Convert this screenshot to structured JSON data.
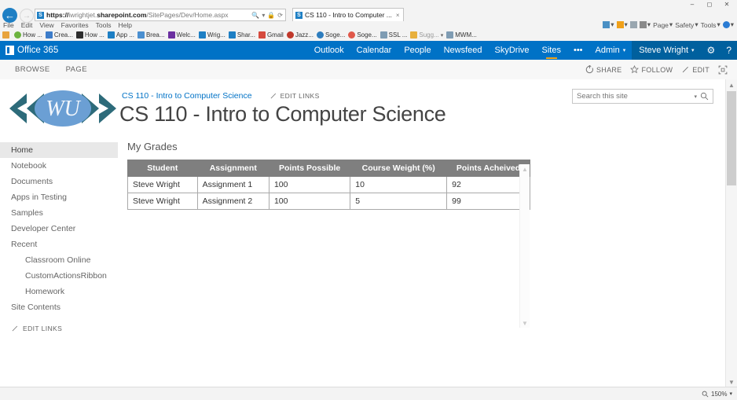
{
  "browser": {
    "window_controls": [
      "minimize",
      "restore",
      "close"
    ],
    "back_icon": "back-arrow-icon",
    "forward_icon": "forward-arrow-icon",
    "address": {
      "scheme": "https://",
      "host_dim": "iwrightjet.",
      "host_bold": "sharepoint.com",
      "path": "/SitePages/Dev/Home.aspx",
      "full_url": "https://iwrightjet.sharepoint.com/SitePages/Dev/Home.aspx",
      "search_icon": "search-icon",
      "lock_icon": "lock-icon",
      "refresh_icon": "refresh-icon"
    },
    "tab": {
      "title": "CS 110 - Intro to Computer ...",
      "close_label": "×"
    },
    "menus": [
      "File",
      "Edit",
      "View",
      "Favorites",
      "Tools",
      "Help"
    ],
    "command_items": [
      {
        "label": "",
        "icon": "home-icon",
        "color": "#4a90c4"
      },
      {
        "label": "",
        "icon": "feed-icon",
        "color": "#f0a019"
      },
      {
        "label": "",
        "icon": "mail-icon",
        "color": "#9aa7b0"
      },
      {
        "label": "",
        "icon": "print-icon",
        "color": "#6f6f6f"
      },
      {
        "label": "Page",
        "icon": "page-menu",
        "color": ""
      },
      {
        "label": "Safety",
        "icon": "safety-menu",
        "color": ""
      },
      {
        "label": "Tools",
        "icon": "tools-menu",
        "color": ""
      },
      {
        "label": "",
        "icon": "help-icon",
        "color": "#2b7cd3"
      }
    ],
    "bookmarks": [
      {
        "label": "",
        "icon": "home-bookmark-icon",
        "color": "#e8a33d"
      },
      {
        "label": "How ...",
        "icon": "favicon",
        "color": "#6cb33f"
      },
      {
        "label": "Crea...",
        "icon": "favicon",
        "color": "#3d7cc9"
      },
      {
        "label": "How ...",
        "icon": "favicon",
        "color": "#2d2d2d"
      },
      {
        "label": "App ...",
        "icon": "favicon",
        "color": "#1e7fc4"
      },
      {
        "label": "Brea...",
        "icon": "favicon",
        "color": "#4a8fd0"
      },
      {
        "label": "Welc...",
        "icon": "favicon",
        "color": "#6b2fa0"
      },
      {
        "label": "Wrig...",
        "icon": "favicon",
        "color": "#1e7fc4"
      },
      {
        "label": "Shar...",
        "icon": "favicon",
        "color": "#1e7fc4"
      },
      {
        "label": "Gmail",
        "icon": "gmail-icon",
        "color": "#d64b3e"
      },
      {
        "label": "Jazz...",
        "icon": "favicon",
        "color": "#c0392b"
      },
      {
        "label": "Soge...",
        "icon": "favicon",
        "color": "#2e7dbe"
      },
      {
        "label": "Soge...",
        "icon": "favicon",
        "color": "#e0584a"
      },
      {
        "label": "SSL ...",
        "icon": "favicon",
        "color": "#7f9cb3"
      },
      {
        "label": "Sugg...",
        "icon": "folder-icon",
        "color": "#e8b03d"
      },
      {
        "label": "MWM...",
        "icon": "favicon",
        "color": "#7f9cb3"
      }
    ],
    "status": {
      "zoom": "150%",
      "zoom_icon": "zoom-icon"
    }
  },
  "suitebar": {
    "brand": "Office 365",
    "brand_icon": "office-tile-icon",
    "links": [
      {
        "label": "Outlook",
        "active": false
      },
      {
        "label": "Calendar",
        "active": false
      },
      {
        "label": "People",
        "active": false
      },
      {
        "label": "Newsfeed",
        "active": false
      },
      {
        "label": "SkyDrive",
        "active": false
      },
      {
        "label": "Sites",
        "active": true
      }
    ],
    "overflow": "•••",
    "admin": "Admin",
    "user": "Steve Wright",
    "settings_icon": "gear-icon",
    "help_icon": "help-icon",
    "accent_color": "#0072c6",
    "accent_dark": "#00609e",
    "active_underline_color": "#f2a416"
  },
  "ribbon": {
    "tabs": [
      {
        "label": "BROWSE"
      },
      {
        "label": "PAGE"
      }
    ],
    "actions": [
      {
        "label": "SHARE",
        "icon": "share-icon"
      },
      {
        "label": "FOLLOW",
        "icon": "star-icon"
      },
      {
        "label": "EDIT",
        "icon": "pencil-icon"
      }
    ],
    "focus_icon": "focus-on-content-icon"
  },
  "page": {
    "logo_icon": "wu-logo",
    "logo_text": "WU",
    "logo_chevron_color": "#2d6b7a",
    "logo_ellipse_color": "#6b9fd4",
    "breadcrumb": "CS 110 - Intro to Computer Science",
    "edit_links_top": "EDIT LINKS",
    "edit_links_icon": "pencil-icon",
    "title": "CS 110 - Intro to Computer Science",
    "search": {
      "placeholder": "Search this site",
      "value": "",
      "caret_icon": "chevron-down-icon",
      "search_icon": "search-icon"
    }
  },
  "leftnav": {
    "items": [
      {
        "label": "Home",
        "selected": true,
        "sub": false
      },
      {
        "label": "Notebook",
        "selected": false,
        "sub": false
      },
      {
        "label": "Documents",
        "selected": false,
        "sub": false
      },
      {
        "label": "Apps in Testing",
        "selected": false,
        "sub": false
      },
      {
        "label": "Samples",
        "selected": false,
        "sub": false
      },
      {
        "label": "Developer Center",
        "selected": false,
        "sub": false
      },
      {
        "label": "Recent",
        "selected": false,
        "sub": false
      },
      {
        "label": "Classroom Online",
        "selected": false,
        "sub": true
      },
      {
        "label": "CustomActionsRibbon",
        "selected": false,
        "sub": true
      },
      {
        "label": "Homework",
        "selected": false,
        "sub": true
      },
      {
        "label": "Site Contents",
        "selected": false,
        "sub": false
      }
    ],
    "edit_links": "EDIT LINKS",
    "edit_links_icon": "pencil-icon"
  },
  "webpart": {
    "title": "My Grades",
    "scroll_up_icon": "chevron-up-icon",
    "scroll_down_icon": "chevron-down-icon",
    "table": {
      "header_bg": "#7f7f7f",
      "columns": [
        "Student",
        "Assignment",
        "Points Possible",
        "Course Weight (%)",
        "Points Acheived"
      ],
      "rows": [
        [
          "Steve Wright",
          "Assignment 1",
          "100",
          "10",
          "92"
        ],
        [
          "Steve Wright",
          "Assignment 2",
          "100",
          "5",
          "99"
        ]
      ]
    }
  }
}
